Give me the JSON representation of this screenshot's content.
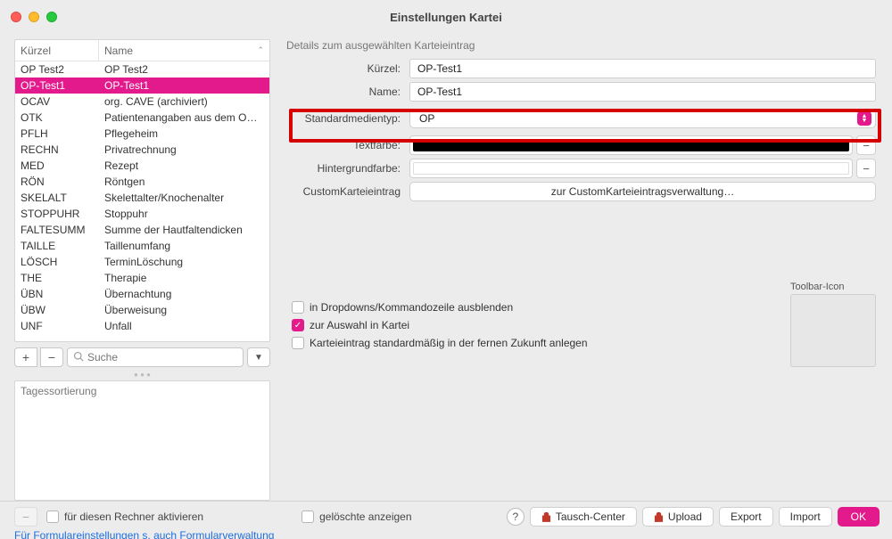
{
  "window": {
    "title": "Einstellungen Kartei"
  },
  "left": {
    "header_kurz": "Kürzel",
    "header_name": "Name",
    "rows": [
      {
        "k": "OP Test2",
        "n": "OP Test2"
      },
      {
        "k": "OP-Test1",
        "n": "OP-Test1"
      },
      {
        "k": "OCAV",
        "n": "org. CAVE (archiviert)"
      },
      {
        "k": "OTK",
        "n": "Patientenangaben aus dem O…"
      },
      {
        "k": "PFLH",
        "n": "Pflegeheim"
      },
      {
        "k": "RECHN",
        "n": "Privatrechnung"
      },
      {
        "k": "MED",
        "n": "Rezept"
      },
      {
        "k": "RÖN",
        "n": "Röntgen"
      },
      {
        "k": "SKELALT",
        "n": "Skelettalter/Knochenalter"
      },
      {
        "k": "STOPPUHR",
        "n": "Stoppuhr"
      },
      {
        "k": "FALTESUMM",
        "n": "Summe der Hautfaltendicken"
      },
      {
        "k": "TAILLE",
        "n": "Taillenumfang"
      },
      {
        "k": "LÖSCH",
        "n": "TerminLöschung"
      },
      {
        "k": "THE",
        "n": "Therapie"
      },
      {
        "k": "ÜBN",
        "n": "Übernachtung"
      },
      {
        "k": "ÜBW",
        "n": "Überweisung"
      },
      {
        "k": "UNF",
        "n": "Unfall"
      }
    ],
    "selected_index": 1,
    "search_placeholder": "Suche",
    "tagessortierung_label": "Tagessortierung"
  },
  "right": {
    "section_label": "Details zum ausgewählten Karteieintrag",
    "labels": {
      "kurz": "Kürzel:",
      "name": "Name:",
      "stdmedientyp": "Standardmedientyp:",
      "textfarbe": "Textfarbe:",
      "hintergrund": "Hintergrundfarbe:",
      "custom": "CustomKarteieintrag"
    },
    "values": {
      "kurz": "OP-Test1",
      "name": "OP-Test1",
      "stdmedientyp": "OP"
    },
    "custom_button": "zur CustomKarteieintragsverwaltung…",
    "checks": {
      "c1_label": "in Dropdowns/Kommandozeile ausblenden",
      "c2_label": "zur Auswahl in Kartei",
      "c3_label": "Karteieintrag standardmäßig in der fernen Zukunft anlegen"
    },
    "toolbar_icon_label": "Toolbar-Icon"
  },
  "footer": {
    "activate_label": "für diesen Rechner aktivieren",
    "deleted_label": "gelöschte anzeigen",
    "buttons": {
      "tausch": "Tausch-Center",
      "upload": "Upload",
      "export": "Export",
      "import": "Import",
      "ok": "OK"
    },
    "link": "Für Formulareinstellungen s. auch Formularverwaltung"
  }
}
